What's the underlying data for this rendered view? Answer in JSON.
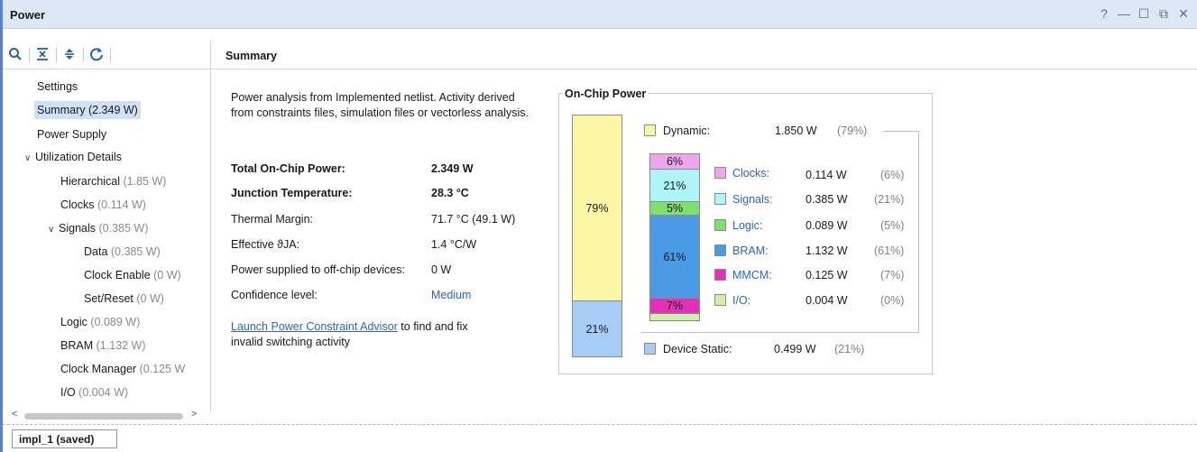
{
  "window": {
    "title": "Power",
    "controls": [
      "?",
      "—",
      "☐",
      "⧉",
      "✕"
    ]
  },
  "toolbar": {
    "icons": [
      "search-icon",
      "collapse-all-icon",
      "expand-all-icon",
      "refresh-icon"
    ]
  },
  "tree": {
    "settings": "Settings",
    "summary": "Summary (2.349 W)",
    "power_supply": "Power Supply",
    "utilization": "Utilization Details",
    "hier_label": "Hierarchical",
    "hier_val": "(1.85 W)",
    "clocks_label": "Clocks",
    "clocks_val": "(0.114 W)",
    "signals_label": "Signals",
    "signals_val": "(0.385 W)",
    "data_label": "Data",
    "data_val": "(0.385 W)",
    "ce_label": "Clock Enable",
    "ce_val": "(0 W)",
    "sr_label": "Set/Reset",
    "sr_val": "(0 W)",
    "logic_label": "Logic",
    "logic_val": "(0.089 W)",
    "bram_label": "BRAM",
    "bram_val": "(1.132 W)",
    "cm_label": "Clock Manager",
    "cm_val": "(0.125 W",
    "io_label": "I/O",
    "io_val": "(0.004 W)"
  },
  "summary_header": "Summary",
  "summary": {
    "description": "Power analysis from Implemented netlist. Activity derived from constraints files, simulation files or vectorless analysis.",
    "rows": [
      {
        "label": "Total On-Chip Power:",
        "value": "2.349 W"
      },
      {
        "label": "Junction Temperature:",
        "value": "28.3 °C"
      },
      {
        "label": "Thermal Margin:",
        "value": "71.7 °C (49.1 W)"
      },
      {
        "label": "Effective ϑJA:",
        "value": "1.4 °C/W"
      },
      {
        "label": "Power supplied to off-chip devices:",
        "value": "0 W"
      },
      {
        "label": "Confidence level:",
        "value": "Medium"
      }
    ],
    "advisor_link": "Launch Power Constraint Advisor",
    "advisor_rest": " to find and fix",
    "advisor_rest2": "invalid switching activity"
  },
  "onchip": {
    "title": "On-Chip Power",
    "dynamic_pct": "79%",
    "static_pct": "21%",
    "dynamic": {
      "label": "Dynamic:",
      "value": "1.850 W",
      "pct": "(79%)"
    },
    "static": {
      "label": "Device Static:",
      "value": "0.499 W",
      "pct": "(21%)"
    },
    "breakdown": [
      {
        "label": "Clocks:",
        "value": "0.114 W",
        "pct": "(6%)",
        "bar": "6%",
        "color": "#f0a6ee"
      },
      {
        "label": "Signals:",
        "value": "0.385 W",
        "pct": "(21%)",
        "bar": "21%",
        "color": "#aef5f8"
      },
      {
        "label": "Logic:",
        "value": "0.089 W",
        "pct": "(5%)",
        "bar": "5%",
        "color": "#7fe06b"
      },
      {
        "label": "BRAM:",
        "value": "1.132 W",
        "pct": "(61%)",
        "bar": "61%",
        "color": "#4a9be6"
      },
      {
        "label": "MMCM:",
        "value": "0.125 W",
        "pct": "(7%)",
        "bar": "7%",
        "color": "#e42fb9"
      },
      {
        "label": "I/O:",
        "value": "0.004 W",
        "pct": "(0%)",
        "bar": "",
        "color": "#cdf4a4"
      }
    ],
    "colors": {
      "dynamic": "#fcf7a4",
      "static": "#a6cdf5"
    }
  },
  "bottom_tab": "impl_1 (saved)"
}
